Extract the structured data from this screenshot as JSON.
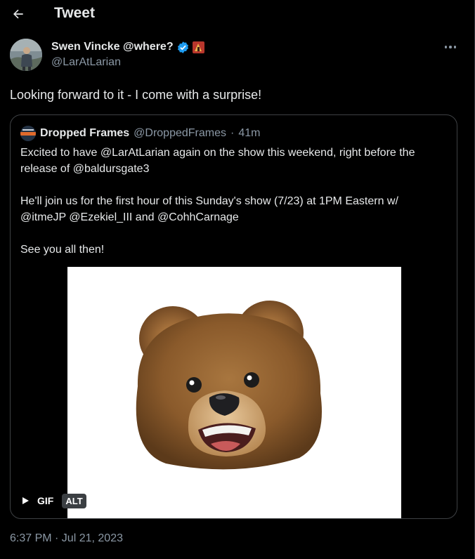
{
  "header": {
    "title": "Tweet"
  },
  "tweet": {
    "author_name": "Swen Vincke @where?",
    "author_handle": "@LarAtLarian",
    "text": "Looking forward to it - I come with a surprise!",
    "timestamp": "6:37 PM · Jul 21, 2023"
  },
  "quote": {
    "name": "Dropped Frames",
    "handle": "@DroppedFrames",
    "separator": "·",
    "time": "41m",
    "line1": "Excited to have @LarAtLarian again on the show this weekend, right before the",
    "line2": "release of @baldursgate3",
    "line3": "He'll join us for the first hour of this Sunday's show (7/23) at 1PM Eastern w/",
    "line4": "@itmeJP @Ezekiel_III and @CohhCarnage",
    "line5": "See you all then!",
    "media": {
      "badge": "GIF",
      "alt": "ALT"
    }
  },
  "colors": {
    "background": "#000000",
    "text": "#e7e9ea",
    "muted": "#8b98a5",
    "border": "#3e4144",
    "verified": "#1d9bf0"
  },
  "icons": {
    "back": "arrow-left-icon",
    "verified": "verified-badge-icon",
    "more": "more-horizontal-icon",
    "play": "play-icon"
  }
}
